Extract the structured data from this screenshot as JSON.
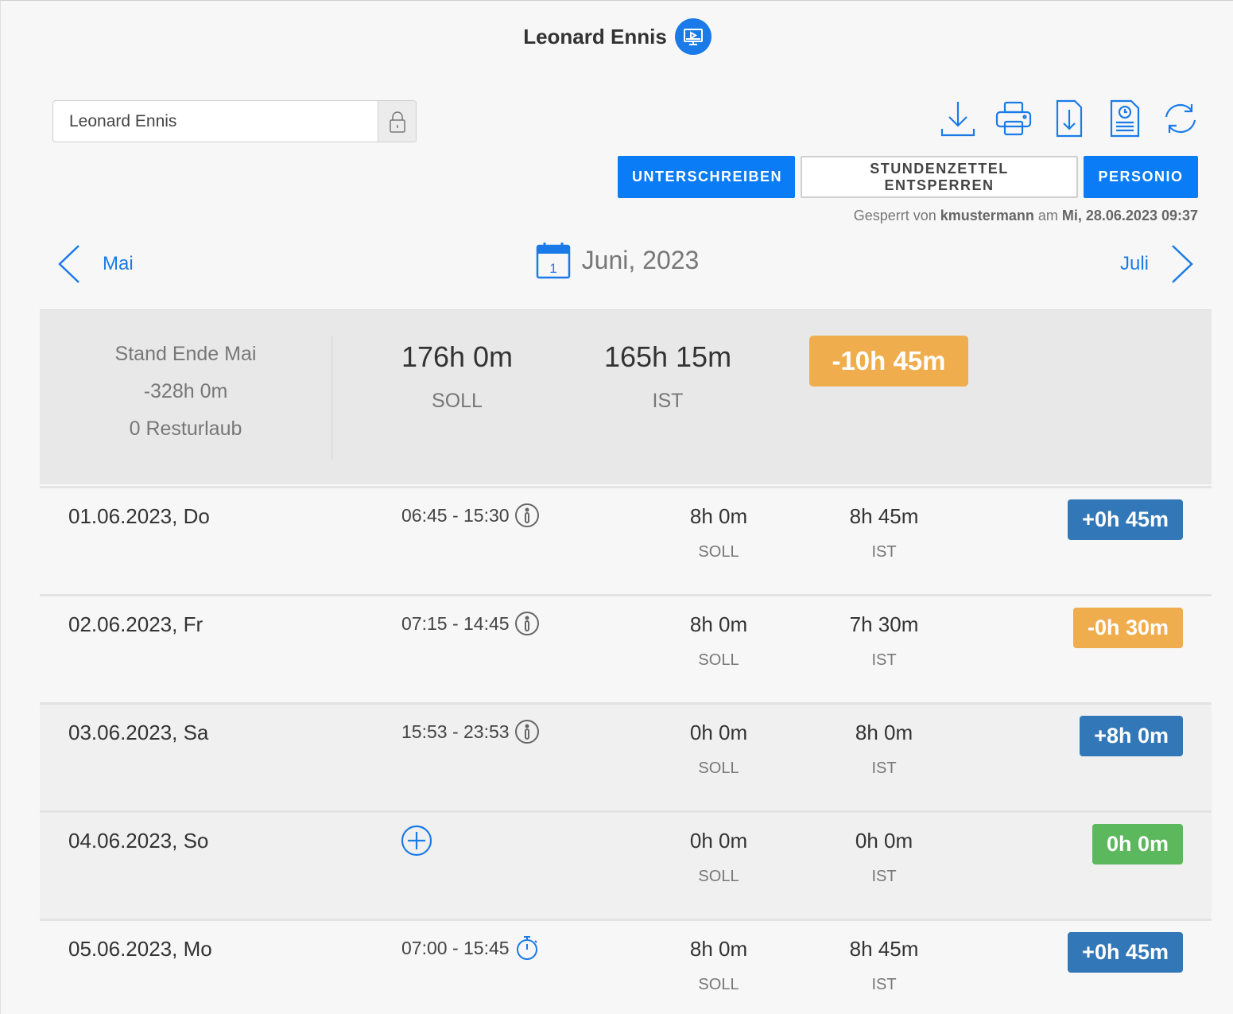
{
  "header": {
    "title": "Leonard Ennis",
    "badge_icon": "monitor-play-icon"
  },
  "employee": {
    "value": "Leonard Ennis",
    "lock_icon": "lock-icon"
  },
  "toolbar": {
    "icons": [
      "download-icon",
      "print-icon",
      "file-download-icon",
      "timesheet-document-icon",
      "refresh-icon"
    ]
  },
  "actions": {
    "sign_label": "UNTERSCHREIBEN",
    "unlock_label": "STUNDENZETTEL ENTSPERREN",
    "personio_label": "PERSONIO"
  },
  "lock_note": {
    "prefix": "Gesperrt von",
    "user": "kmustermann",
    "mid": "am",
    "date": "Mi, 28.06.2023 09:37"
  },
  "month_nav": {
    "prev_label": "Mai",
    "current": "Juni, 2023",
    "calendar_day": "1",
    "next_label": "Juli"
  },
  "summary": {
    "carry_title": "Stand Ende Mai",
    "carry_value": "-328h 0m",
    "carry_vacation": "0 Resturlaub",
    "soll_value": "176h 0m",
    "soll_label": "SOLL",
    "ist_value": "165h 15m",
    "ist_label": "IST",
    "balance": "-10h 45m",
    "balance_color": "#f0ad4e"
  },
  "days": [
    {
      "date": "01.06.2023, Do",
      "time": "06:45 - 15:30",
      "time_icon": "info-icon",
      "soll": "8h 0m",
      "soll_label": "SOLL",
      "ist": "8h 45m",
      "ist_label": "IST",
      "diff": "+0h 45m",
      "diff_color": "#3278b8"
    },
    {
      "date": "02.06.2023, Fr",
      "time": "07:15 - 14:45",
      "time_icon": "info-icon",
      "soll": "8h 0m",
      "soll_label": "SOLL",
      "ist": "7h 30m",
      "ist_label": "IST",
      "diff": "-0h 30m",
      "diff_color": "#f0ad4e"
    },
    {
      "date": "03.06.2023, Sa",
      "time": "15:53 - 23:53",
      "time_icon": "info-icon",
      "soll": "0h 0m",
      "soll_label": "SOLL",
      "ist": "8h 0m",
      "ist_label": "IST",
      "diff": "+8h 0m",
      "diff_color": "#3278b8"
    },
    {
      "date": "04.06.2023, So",
      "time": "",
      "time_icon": "add-circle-icon",
      "soll": "0h 0m",
      "soll_label": "SOLL",
      "ist": "0h 0m",
      "ist_label": "IST",
      "diff": "0h 0m",
      "diff_color": "#5cb85c"
    },
    {
      "date": "05.06.2023, Mo",
      "time": "07:00 - 15:45",
      "time_icon": "stopwatch-icon",
      "soll": "8h 0m",
      "soll_label": "SOLL",
      "ist": "8h 45m",
      "ist_label": "IST",
      "diff": "+0h 45m",
      "diff_color": "#3278b8"
    }
  ]
}
